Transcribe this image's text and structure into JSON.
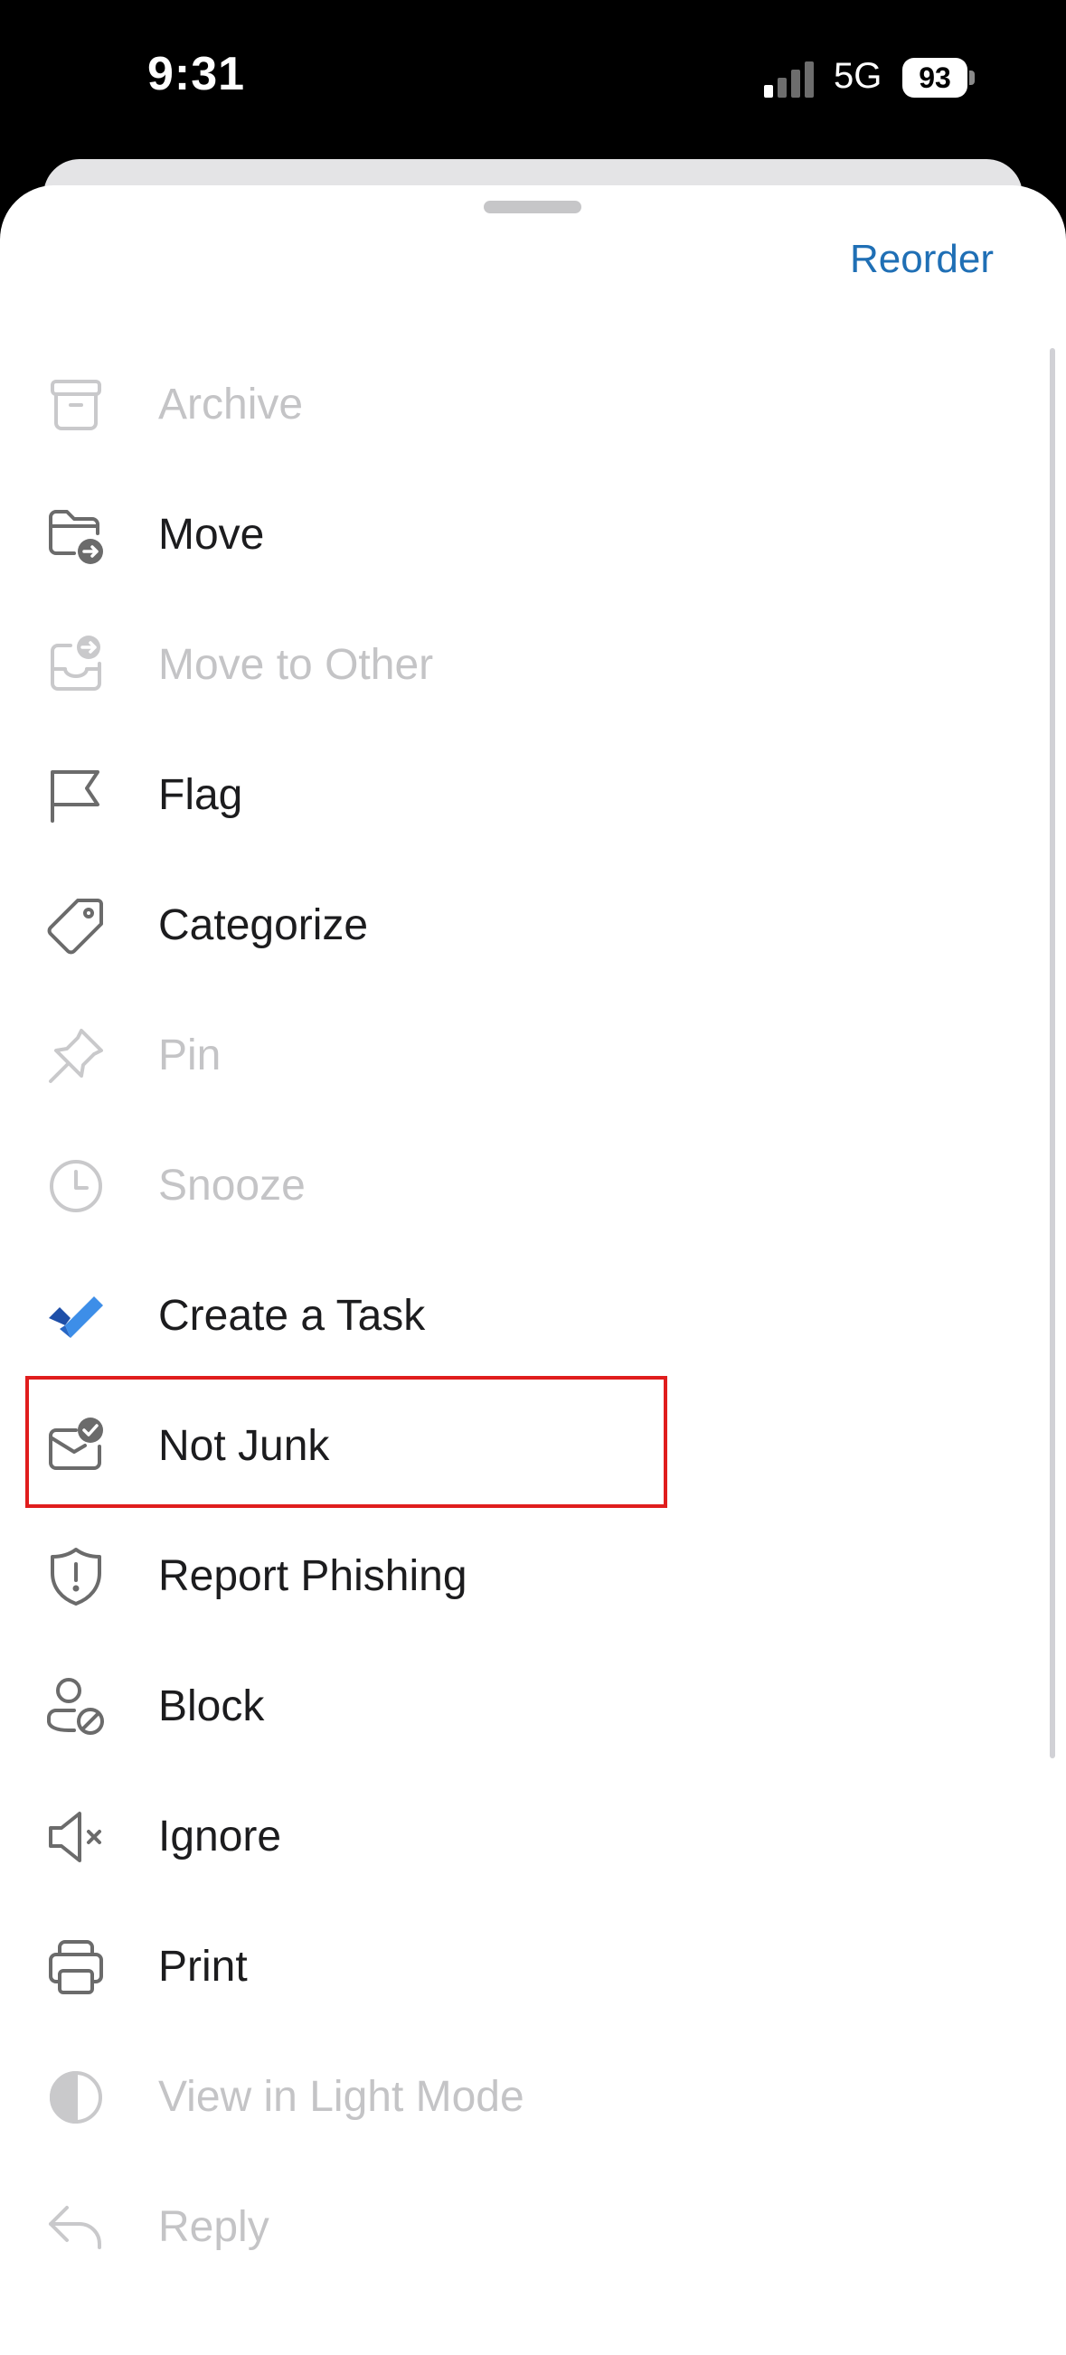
{
  "status_bar": {
    "time": "9:31",
    "network": "5G",
    "battery": "93"
  },
  "sheet": {
    "reorder_label": "Reorder"
  },
  "menu": {
    "items": [
      {
        "label": "Archive",
        "icon": "archive-icon",
        "enabled": false
      },
      {
        "label": "Move",
        "icon": "folder-move-icon",
        "enabled": true
      },
      {
        "label": "Move to Other",
        "icon": "inbox-move-icon",
        "enabled": false
      },
      {
        "label": "Flag",
        "icon": "flag-icon",
        "enabled": true
      },
      {
        "label": "Categorize",
        "icon": "tag-icon",
        "enabled": true
      },
      {
        "label": "Pin",
        "icon": "pin-icon",
        "enabled": false
      },
      {
        "label": "Snooze",
        "icon": "clock-icon",
        "enabled": false
      },
      {
        "label": "Create a Task",
        "icon": "todo-check-icon",
        "enabled": true
      },
      {
        "label": "Not Junk",
        "icon": "mail-check-icon",
        "enabled": true
      },
      {
        "label": "Report Phishing",
        "icon": "shield-alert-icon",
        "enabled": true
      },
      {
        "label": "Block",
        "icon": "person-block-icon",
        "enabled": true
      },
      {
        "label": "Ignore",
        "icon": "speaker-mute-icon",
        "enabled": true
      },
      {
        "label": "Print",
        "icon": "printer-icon",
        "enabled": true
      },
      {
        "label": "View in Light Mode",
        "icon": "half-circle-icon",
        "enabled": false
      },
      {
        "label": "Reply",
        "icon": "reply-icon",
        "enabled": false
      }
    ]
  },
  "colors": {
    "accent": "#1f6fb5",
    "highlight_border": "#e01d1d",
    "task_blue": "#2f7bd8"
  }
}
